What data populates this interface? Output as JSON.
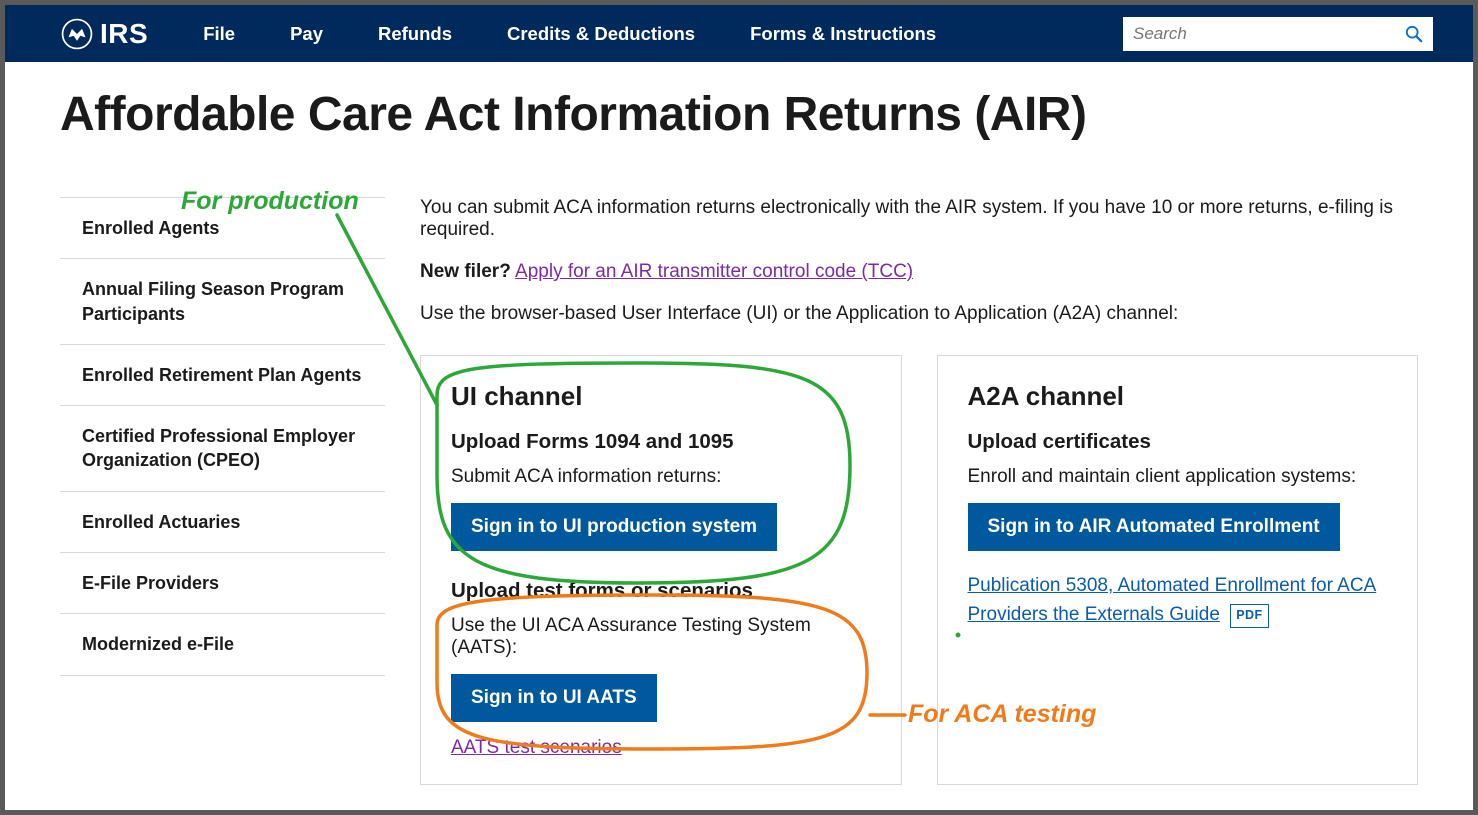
{
  "brand": "IRS",
  "nav": [
    "File",
    "Pay",
    "Refunds",
    "Credits & Deductions",
    "Forms & Instructions"
  ],
  "search_placeholder": "Search",
  "page_title": "Affordable Care Act Information Returns (AIR)",
  "sidebar": [
    "Enrolled Agents",
    "Annual Filing Season Program Participants",
    "Enrolled Retirement Plan Agents",
    "Certified Professional Employer Organization (CPEO)",
    "Enrolled Actuaries",
    "E-File Providers",
    "Modernized e-File"
  ],
  "intro": "You can submit ACA information returns electronically with the AIR system. If you have 10 or more returns, e-filing is required.",
  "new_filer_label": "New filer?",
  "new_filer_link": "Apply for an AIR transmitter control code (TCC)",
  "choose_line": "Use the browser-based User Interface (UI) or the Application to Application (A2A) channel:",
  "ui_card": {
    "heading": "UI channel",
    "h3a": "Upload Forms 1094 and 1095",
    "p_a": "Submit ACA information returns:",
    "btn_a": "Sign in to UI production system",
    "h3b": "Upload test forms or scenarios",
    "p_b": "Use the UI ACA Assurance Testing System (AATS):",
    "btn_b": "Sign in to UI AATS",
    "link": "AATS test scenarios"
  },
  "a2a_card": {
    "heading": "A2A channel",
    "h3a": "Upload certificates",
    "p_a": "Enroll and maintain client application systems:",
    "btn_a": "Sign in to AIR Automated Enrollment",
    "pub_link": "Publication 5308, Automated Enrollment for ACA Providers the Externals Guide",
    "pdf": "PDF"
  },
  "annotations": {
    "production": "For production",
    "testing": "For ACA testing"
  }
}
